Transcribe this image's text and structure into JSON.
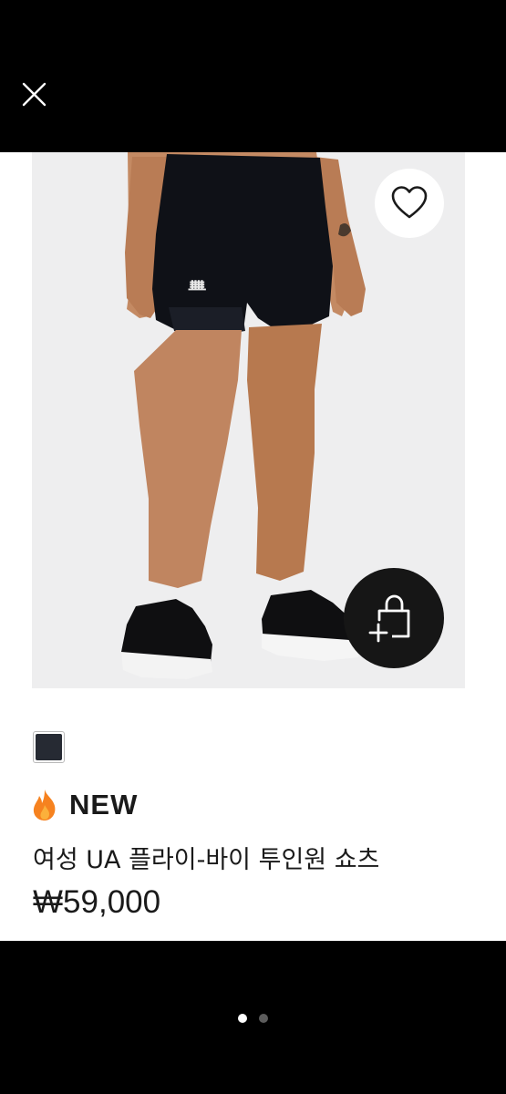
{
  "header": {
    "close_icon": "close-icon"
  },
  "product": {
    "image_icon": "product-photo",
    "wishlist_icon": "heart-outline-icon",
    "add_to_cart_icon": "bag-plus-icon",
    "color_swatches": [
      {
        "color": "#262a33",
        "selected": true
      }
    ],
    "badge": {
      "icon": "fire-icon",
      "label": "NEW"
    },
    "name": "여성 UA 플라이-바이 투인원 쇼츠",
    "price": "₩59,000"
  },
  "pager": {
    "total": 2,
    "active_index": 0
  },
  "colors": {
    "background": "#000000",
    "card": "#ffffff",
    "photo_bg": "#eeeeef",
    "text": "#1a1a1a",
    "cart_button": "#161616",
    "fire": "#f6821f",
    "dot_active": "#ffffff",
    "dot_inactive": "#5c5c5c"
  }
}
